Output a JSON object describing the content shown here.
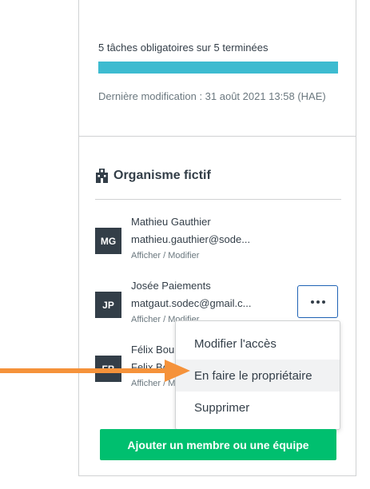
{
  "progress": {
    "tasks_text": "5 tâches obligatoires sur 5 terminées",
    "percent": 100,
    "fill_color": "#3dbbd0",
    "last_modified": "Dernière modification : 31 août 2021 13:58 (HAE)"
  },
  "organization": {
    "icon": "building-icon",
    "title": "Organisme fictif"
  },
  "members": [
    {
      "initials": "MG",
      "name": "Mathieu Gauthier",
      "email": "mathieu.gauthier@sode...",
      "link": "Afficher / Modifier"
    },
    {
      "initials": "JP",
      "name": "Josée Paiements",
      "email": "matgaut.sodec@gmail.c...",
      "link": "Afficher / Modifier"
    },
    {
      "initials": "FB",
      "name": "Félix Bou",
      "email": "Felix.Bo",
      "link": "Afficher / Mo"
    }
  ],
  "more_button": {
    "icon": "more-options-icon"
  },
  "menu": {
    "items": [
      "Modifier l'accès",
      "En faire le propriétaire",
      "Supprimer"
    ],
    "highlighted_index": 1
  },
  "add_button": {
    "label": "Ajouter un membre ou une équipe",
    "color": "#00bf6f"
  },
  "annotation": {
    "arrow_color": "#f5923a"
  }
}
